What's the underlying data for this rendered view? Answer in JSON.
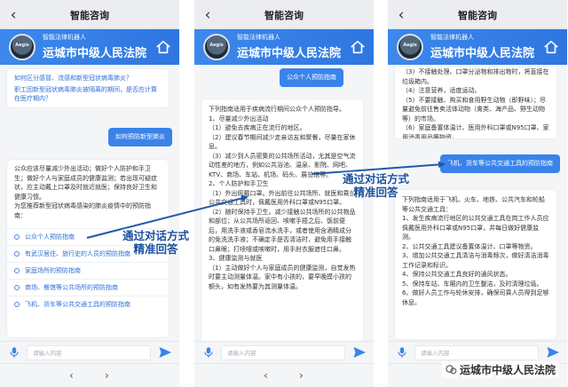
{
  "app": {
    "window_title": "智能咨询",
    "header_subtitle": "智能法律机器人",
    "header_title": "运城市中级人民法院",
    "robot_label": "Aegis",
    "input_placeholder": "请输入内容",
    "nav": {
      "back": "‹",
      "forward": "›"
    }
  },
  "screens": {
    "screen1": {
      "faq_links": [
        "如何区分感冒、流感和新型冠状病毒肺炎？",
        "职工因新型冠状病毒肺炎被隔离的期间，是否应计算在医疗期内？"
      ],
      "user_bubble": "如何预防新型肺炎",
      "answer": "公众应该尽量减少外出活动；做好个人防护和手卫生；做好个人与家庭成员的健康监测；若出现可疑症状，应主动戴上口罩及时就近就医；保持良好卫生和健康习惯。\n为您推荐新型冠状病毒感染的肺炎疫情中的预防指南：",
      "options": [
        "公众个人预防指南",
        "有武汉居住、旅行史的人员的预防指南",
        "家庭场所的预防指南",
        "商场、餐馆等公共场所的预防指南",
        "飞机、货车等公共交通工具的预防指南"
      ]
    },
    "screen2": {
      "user_bubble": "公众个人预防指南",
      "answer": "下列指南适用于疾病流行期间公众个人预防指导。\n1、尽量减少外出活动\n（1）避免去疾病正在流行的地区。\n（2）建议春节期间减少走亲访友和聚餐，尽量在家休息。\n（3）减少到人员密集的公共场所活动，尤其是空气流动性差的地方，例如公共浴池、温泉、影院、网吧、KTV、商场、车站、机场、码头、展览馆等。\n2、个人防护和手卫生\n（1）外出佩戴口罩。外出前往公共场所、就医和乘坐公共交通工具时，佩戴医用外科口罩或N95口罩。\n（2）随时保持手卫生。减少接触公共场所的公共物品和部位；从公共场所返回、咳嗽手捂之后、饭前便后，用洗手液或香皂流水洗手，或者使用含酒精成分的免洗洗手液；不确定手是否清洁时，避免用手接触口鼻眼；打喷嚏或咳嗽时，用手肘衣服遮住口鼻。\n3、健康监测与就医\n（1）主动做好个人与家庭成员的健康监测，自觉发热时要主动测量体温。家中有小孩的，要早晚摸小孩的额头，如有发热要为其测量体温。"
    },
    "screen3": {
      "answer_top": "（3）不接触处理、口罩分泌物和排出物时，将直接在垃圾箱内。\n（4）注意营养，适度运动。\n（5）不要接触、购买和食用野生动物（即野味）；尽量避免前往售卖活体动物（禽类、海产品、野生动物等）的市场。\n（6）家庭备置体温计、医用外科口罩或N95口罩、家用消毒用品等物资。",
      "user_bubble": "飞机、货车等公共交通工具的预防指南",
      "answer": "下列指南适用于飞机、火车、地铁、公共汽车和轮船等公共交通工具：\n1、发生疾病流行地区的公共交通工具在岗工作人员应佩戴医用外科口罩或N95口罩，并每日做好健康监测。\n2、公共交通工具建议备置体温计、口罩等物资。\n3、增加公共交通工具清洁与消毒频次，做好清洁消毒工作记录和标识。\n4、保持公共交通工具良好的通风状态。\n5、保持车站、车厢内的卫生整洁，及时清理垃圾。\n6、做好人员工作与轮休安排，确保司乘人员得到足够休息。"
    }
  },
  "annotations": {
    "overlay1": "通过对话方式\n精准回答",
    "overlay2": "通过对话方式\n精准回答",
    "watermark": "运城市中级人民法院"
  },
  "colors": {
    "header_blue": "#3c88ec",
    "bubble_blue": "#3a83ea",
    "link_blue": "#2f6fd6",
    "annotation_blue": "#1b4f9c"
  }
}
